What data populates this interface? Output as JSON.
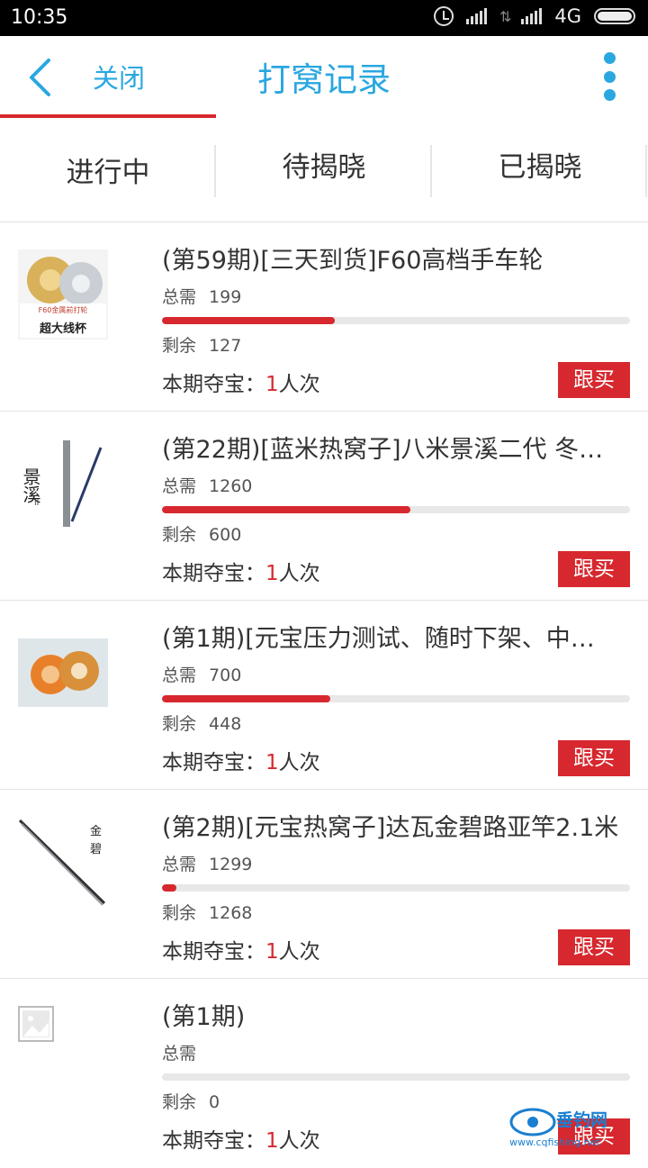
{
  "status_bar": {
    "time": "10:35",
    "network": "4G"
  },
  "header": {
    "close_label": "关闭",
    "title": "打窝记录"
  },
  "tabs": [
    {
      "label": "进行中",
      "active": true
    },
    {
      "label": "待揭晓",
      "active": false
    },
    {
      "label": "已揭晓",
      "active": false
    }
  ],
  "items": [
    {
      "name": "(第59期)[三天到货]F60高档手车轮",
      "need_label": "总需",
      "need_value": "199",
      "remain_label": "剩余",
      "remain_value": "127",
      "progress": 0.37,
      "treasure_label": "本期夺宝：",
      "treasure_count": "1",
      "treasure_unit": "人次",
      "button_label": "跟买",
      "thumb_text_1": "F60金属前打轮",
      "thumb_text_2": "超大线杯"
    },
    {
      "name": "(第22期)[蓝米热窝子]八米景溪二代 冬…",
      "need_label": "总需",
      "need_value": "1260",
      "remain_label": "剩余",
      "remain_value": "600",
      "progress": 0.53,
      "treasure_label": "本期夺宝：",
      "treasure_count": "1",
      "treasure_unit": "人次",
      "button_label": "跟买",
      "thumb_text_1": "景溪",
      "thumb_text_2": "II"
    },
    {
      "name": "(第1期)[元宝压力测试、随时下架、中…",
      "need_label": "总需",
      "need_value": "700",
      "remain_label": "剩余",
      "remain_value": "448",
      "progress": 0.36,
      "treasure_label": "本期夺宝：",
      "treasure_count": "1",
      "treasure_unit": "人次",
      "button_label": "跟买"
    },
    {
      "name": "(第2期)[元宝热窝子]达瓦金碧路亚竿2.1米",
      "need_label": "总需",
      "need_value": "1299",
      "remain_label": "剩余",
      "remain_value": "1268",
      "progress": 0.03,
      "treasure_label": "本期夺宝：",
      "treasure_count": "1",
      "treasure_unit": "人次",
      "button_label": "跟买",
      "thumb_text_1": "金",
      "thumb_text_2": "碧"
    },
    {
      "name": "(第1期)",
      "need_label": "总需",
      "need_value": "",
      "remain_label": "剩余",
      "remain_value": "0",
      "progress": 0,
      "treasure_label": "本期夺宝：",
      "treasure_count": "1",
      "treasure_unit": "人次",
      "button_label": "跟买"
    }
  ],
  "watermark": {
    "brand": "垂钓网",
    "url": "www.cqfishing.net"
  },
  "colors": {
    "accent_blue": "#2aa7e0",
    "accent_red": "#d6282e"
  }
}
